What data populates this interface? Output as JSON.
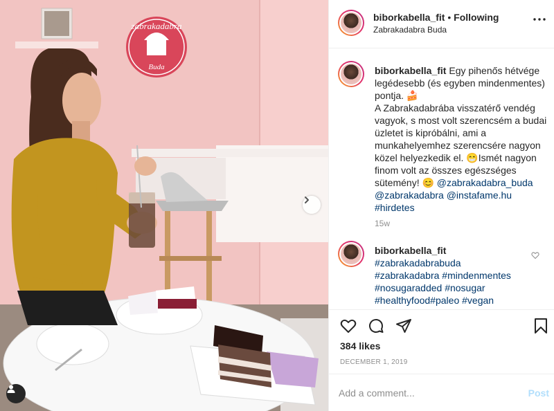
{
  "photo": {
    "logo_text_1": "zabrakadabra",
    "logo_text_2": "Buda",
    "next_icon": "chevron-right-icon",
    "tags_icon": "user-tag-icon"
  },
  "header": {
    "username": "biborkabella_fit",
    "separator": "•",
    "follow_status": "Following",
    "location": "Zabrakadabra Buda",
    "more_icon": "more-options-icon"
  },
  "caption": {
    "username": "biborkabella_fit",
    "line1": "Egy pihenős hétvége legédesebb (és egyben mindenmentes) pontja. 🍰",
    "line2": "A Zabrakadabrába visszatérő vendég vagyok, s most volt szerencsém a budai üzletet is kipróbálni, ami a munkahelyemhez szerencsére nagyon közel helyezkedik el. 😁Ismét nagyon finom volt az összes egészséges sütemény! 😊 ",
    "mention1": "@zabrakadabra_buda",
    "mention2": "@zabrakadabra",
    "mention3": "@instafame.hu",
    "hashtag": "#hirdetes",
    "time": "15w"
  },
  "comment": {
    "username": "biborkabella_fit",
    "tags": [
      "#zabrakadabrabuda",
      "#zabrakadabra",
      "#mindenmentes",
      "#nosugaradded",
      "#nosugar",
      "#healthyfood",
      "#paleo",
      "#vegan"
    ]
  },
  "actions": {
    "like_icon": "heart-icon",
    "comment_icon": "comment-icon",
    "share_icon": "share-icon",
    "save_icon": "bookmark-icon",
    "likes": "384 likes",
    "date": "DECEMBER 1, 2019"
  },
  "add_comment": {
    "placeholder": "Add a comment...",
    "post_label": "Post"
  },
  "colors": {
    "link": "#00376b",
    "muted": "#8e8e8e",
    "post_disabled": "#b2dffc",
    "wall_pink": "#f3c6c4",
    "logo_red": "#d9465a"
  }
}
